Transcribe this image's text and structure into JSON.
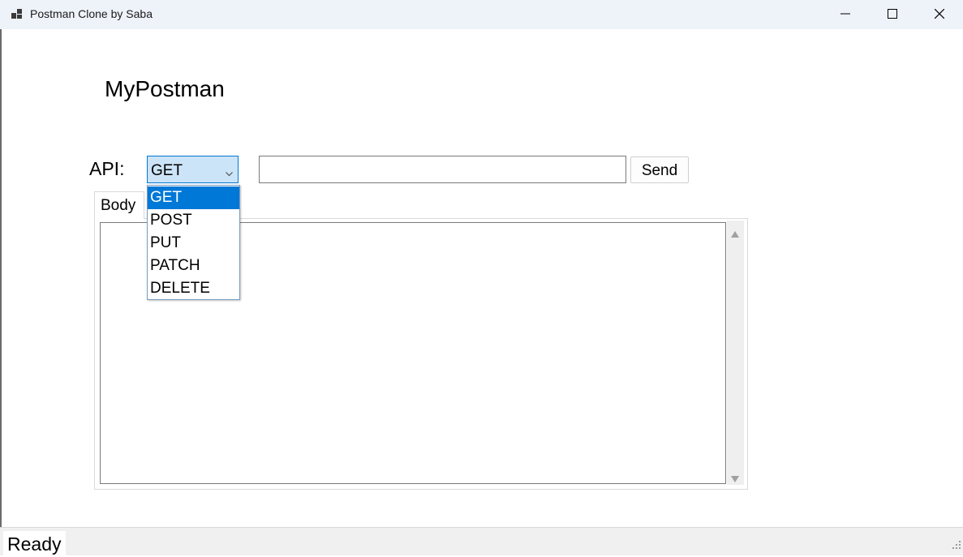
{
  "window": {
    "title": "Postman Clone by Saba",
    "icons": {
      "app": "app-icon",
      "minimize": "minimize-icon",
      "maximize": "maximize-icon",
      "close": "close-icon"
    }
  },
  "main": {
    "heading": "MyPostman",
    "api_label": "API:",
    "method_selected": "GET",
    "method_options": [
      "GET",
      "POST",
      "PUT",
      "PATCH",
      "DELETE"
    ],
    "url_value": "",
    "send_label": "Send",
    "tab_label": "Body",
    "body_value": ""
  },
  "status": {
    "text": "Ready"
  },
  "colors": {
    "accent": "#0078d7",
    "combo_bg": "#cce4f7",
    "titlebar_bg": "#eef2f9"
  }
}
